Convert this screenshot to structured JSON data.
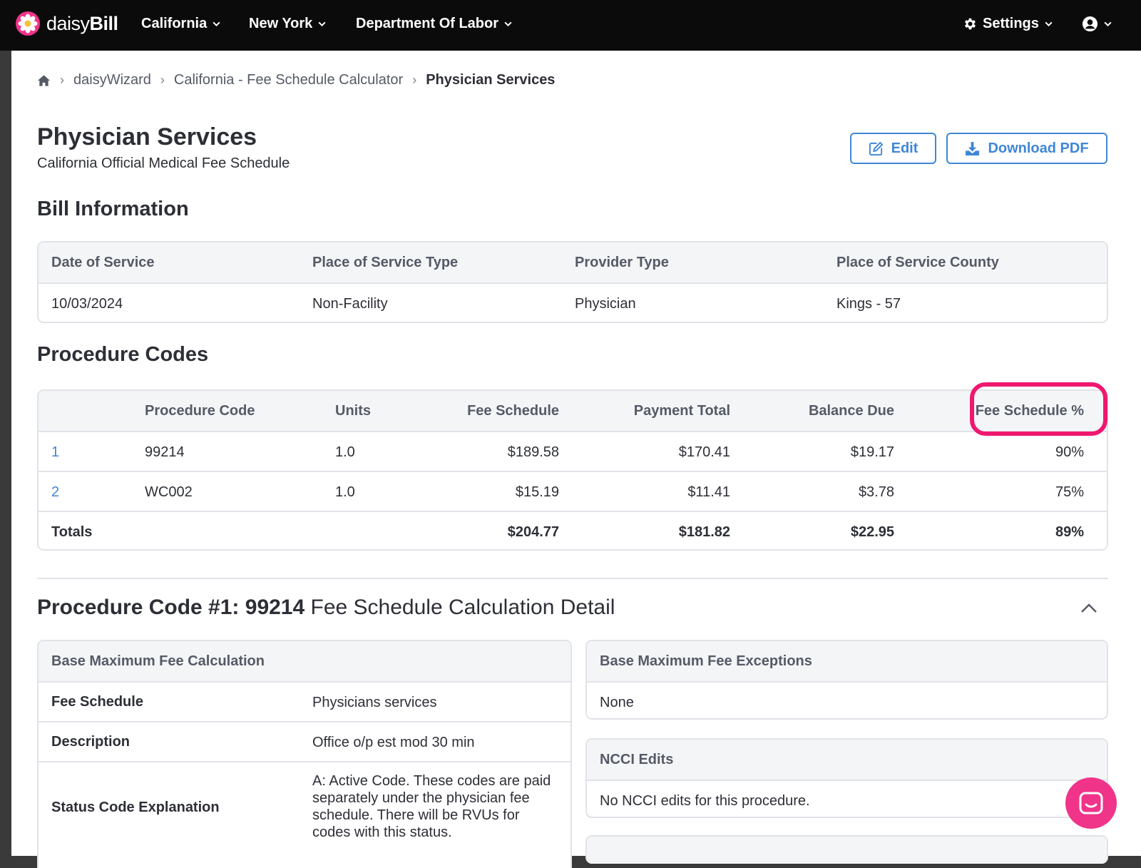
{
  "app": {
    "logo_text_light": "daisy",
    "logo_text_bold": "Bill",
    "nav": [
      "California",
      "New York",
      "Department Of Labor"
    ],
    "settings_label": "Settings"
  },
  "breadcrumb": {
    "items": [
      "daisyWizard",
      "California - Fee Schedule Calculator"
    ],
    "current": "Physician Services"
  },
  "header": {
    "title": "Physician Services",
    "subtitle": "California Official Medical Fee Schedule",
    "edit_label": "Edit",
    "download_label": "Download PDF"
  },
  "bill_info": {
    "title": "Bill Information",
    "columns": [
      "Date of Service",
      "Place of Service Type",
      "Provider Type",
      "Place of Service County"
    ],
    "values": [
      "10/03/2024",
      "Non-Facility",
      "Physician",
      "Kings - 57"
    ]
  },
  "procedure_codes": {
    "title": "Procedure Codes",
    "columns": [
      "Procedure Code",
      "Units",
      "Fee Schedule",
      "Payment Total",
      "Balance Due",
      "Fee Schedule %"
    ],
    "rows": [
      {
        "num": "1",
        "code": "99214",
        "units": "1.0",
        "fee": "$189.58",
        "payment": "$170.41",
        "balance": "$19.17",
        "pct": "90%"
      },
      {
        "num": "2",
        "code": "WC002",
        "units": "1.0",
        "fee": "$15.19",
        "payment": "$11.41",
        "balance": "$3.78",
        "pct": "75%"
      }
    ],
    "totals": {
      "label": "Totals",
      "fee": "$204.77",
      "payment": "$181.82",
      "balance": "$22.95",
      "pct": "89%"
    }
  },
  "detail": {
    "title_bold": "Procedure Code #1: 99214",
    "title_rest": " Fee Schedule Calculation Detail",
    "base_calc": {
      "title": "Base Maximum Fee Calculation",
      "rows": [
        {
          "key": "Fee Schedule",
          "value": "Physicians services"
        },
        {
          "key": "Description",
          "value": "Office o/p est mod 30 min"
        },
        {
          "key": "Status Code Explanation",
          "value": "A: Active Code. These codes are paid separately under the physician fee schedule. There will be RVUs for codes with this status."
        }
      ]
    },
    "exceptions": {
      "title": "Base Maximum Fee Exceptions",
      "value": "None"
    },
    "ncci": {
      "title": "NCCI Edits",
      "value": "No NCCI edits for this procedure."
    }
  },
  "colors": {
    "accent": "#3f87d6",
    "highlight": "#f0176f",
    "chat": "#f0348a"
  },
  "icons": [
    "daisy-logo-icon",
    "chevron-down-icon",
    "gear-icon",
    "user-circle-icon",
    "home-icon",
    "edit-icon",
    "download-icon",
    "chevron-up-icon",
    "chat-icon"
  ]
}
